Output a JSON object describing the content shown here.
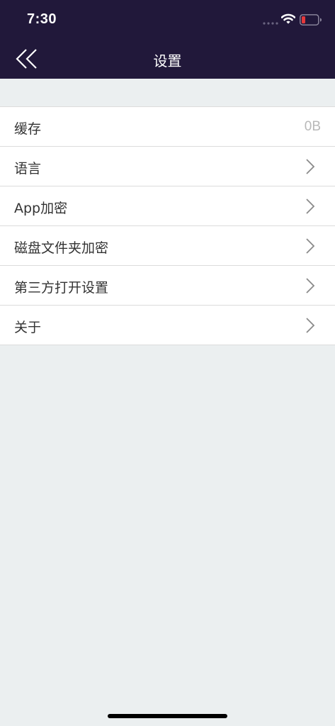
{
  "status_bar": {
    "time": "7:30",
    "icons": [
      "cellular-signal-icon",
      "wifi-icon",
      "battery-low-icon"
    ]
  },
  "header": {
    "title": "设置",
    "back_icon": "double-chevron-left-icon"
  },
  "settings": [
    {
      "label": "缓存",
      "value": "0B"
    },
    {
      "label": "语言"
    },
    {
      "label": "App加密"
    },
    {
      "label": "磁盘文件夹加密"
    },
    {
      "label": "第三方打开设置"
    },
    {
      "label": "关于"
    }
  ],
  "colors": {
    "header_bg": "#21183a",
    "page_bg": "#ebeff0",
    "battery_low": "#e5383b",
    "chevron": "#8a8a8a"
  }
}
